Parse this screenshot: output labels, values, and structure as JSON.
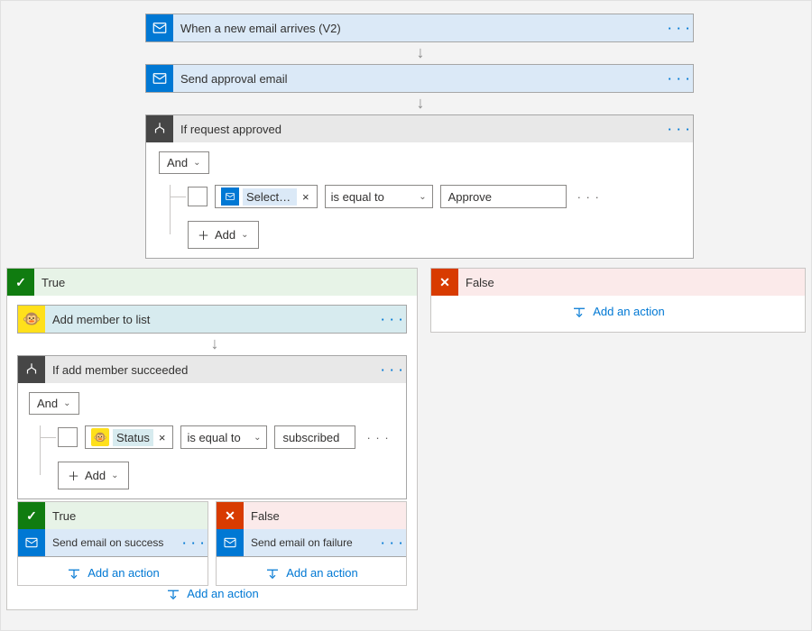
{
  "steps": {
    "s1": "When a new email arrives (V2)",
    "s2": "Send approval email",
    "s3": "If request approved",
    "addMember": "Add member to list",
    "ifSucceeded": "If add member succeeded",
    "sendSuccess": "Send email on success",
    "sendFailure": "Send email on failure"
  },
  "cond1": {
    "group": "And",
    "token": "Selecte...",
    "operator": "is equal to",
    "value": "Approve",
    "addLabel": "Add"
  },
  "cond2": {
    "group": "And",
    "token": "Status",
    "operator": "is equal to",
    "value": "subscribed",
    "addLabel": "Add"
  },
  "branches": {
    "true": "True",
    "false": "False"
  },
  "actions": {
    "addAction": "Add an action"
  },
  "glyphs": {
    "more": "· · ·",
    "check": "✓",
    "x": "✕",
    "chevDown": "⌄",
    "plus": "＋",
    "tokenX": "×"
  }
}
